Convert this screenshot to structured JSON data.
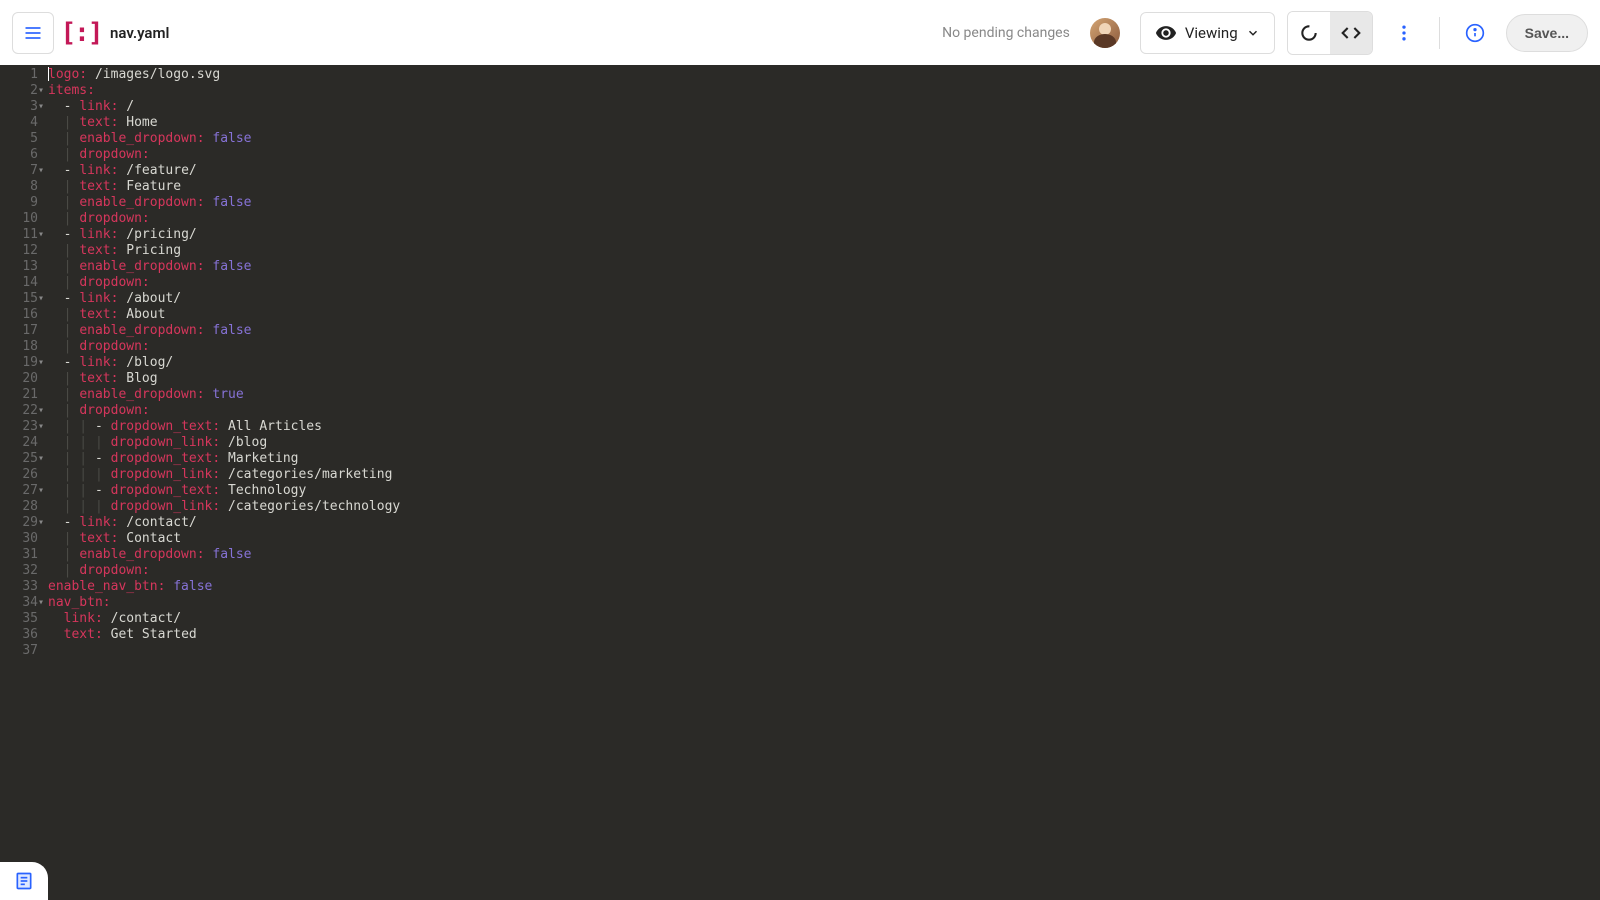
{
  "header": {
    "filename": "nav.yaml",
    "pending_text": "No pending changes",
    "view_mode_label": "Viewing",
    "save_label": "Save..."
  },
  "code_lines": [
    {
      "n": 1,
      "fold": "",
      "segs": [
        {
          "c": "k",
          "t": "logo:"
        },
        {
          "c": "v",
          "t": " /images/logo.svg"
        }
      ]
    },
    {
      "n": 2,
      "fold": "▾",
      "segs": [
        {
          "c": "k",
          "t": "items:"
        }
      ]
    },
    {
      "n": 3,
      "fold": "▾",
      "segs": [
        {
          "c": "pipe",
          "t": "  "
        },
        {
          "c": "dash",
          "t": "- "
        },
        {
          "c": "k",
          "t": "link:"
        },
        {
          "c": "v",
          "t": " /"
        }
      ]
    },
    {
      "n": 4,
      "fold": "",
      "segs": [
        {
          "c": "pipe",
          "t": "  | "
        },
        {
          "c": "k",
          "t": "text:"
        },
        {
          "c": "v",
          "t": " Home"
        }
      ]
    },
    {
      "n": 5,
      "fold": "",
      "segs": [
        {
          "c": "pipe",
          "t": "  | "
        },
        {
          "c": "k",
          "t": "enable_dropdown:"
        },
        {
          "c": "v",
          "t": " "
        },
        {
          "c": "b",
          "t": "false"
        }
      ]
    },
    {
      "n": 6,
      "fold": "",
      "segs": [
        {
          "c": "pipe",
          "t": "  | "
        },
        {
          "c": "k",
          "t": "dropdown:"
        }
      ]
    },
    {
      "n": 7,
      "fold": "▾",
      "segs": [
        {
          "c": "pipe",
          "t": "  "
        },
        {
          "c": "dash",
          "t": "- "
        },
        {
          "c": "k",
          "t": "link:"
        },
        {
          "c": "v",
          "t": " /feature/"
        }
      ]
    },
    {
      "n": 8,
      "fold": "",
      "segs": [
        {
          "c": "pipe",
          "t": "  | "
        },
        {
          "c": "k",
          "t": "text:"
        },
        {
          "c": "v",
          "t": " Feature"
        }
      ]
    },
    {
      "n": 9,
      "fold": "",
      "segs": [
        {
          "c": "pipe",
          "t": "  | "
        },
        {
          "c": "k",
          "t": "enable_dropdown:"
        },
        {
          "c": "v",
          "t": " "
        },
        {
          "c": "b",
          "t": "false"
        }
      ]
    },
    {
      "n": 10,
      "fold": "",
      "segs": [
        {
          "c": "pipe",
          "t": "  | "
        },
        {
          "c": "k",
          "t": "dropdown:"
        }
      ]
    },
    {
      "n": 11,
      "fold": "▾",
      "segs": [
        {
          "c": "pipe",
          "t": "  "
        },
        {
          "c": "dash",
          "t": "- "
        },
        {
          "c": "k",
          "t": "link:"
        },
        {
          "c": "v",
          "t": " /pricing/"
        }
      ]
    },
    {
      "n": 12,
      "fold": "",
      "segs": [
        {
          "c": "pipe",
          "t": "  | "
        },
        {
          "c": "k",
          "t": "text:"
        },
        {
          "c": "v",
          "t": " Pricing"
        }
      ]
    },
    {
      "n": 13,
      "fold": "",
      "segs": [
        {
          "c": "pipe",
          "t": "  | "
        },
        {
          "c": "k",
          "t": "enable_dropdown:"
        },
        {
          "c": "v",
          "t": " "
        },
        {
          "c": "b",
          "t": "false"
        }
      ]
    },
    {
      "n": 14,
      "fold": "",
      "segs": [
        {
          "c": "pipe",
          "t": "  | "
        },
        {
          "c": "k",
          "t": "dropdown:"
        }
      ]
    },
    {
      "n": 15,
      "fold": "▾",
      "segs": [
        {
          "c": "pipe",
          "t": "  "
        },
        {
          "c": "dash",
          "t": "- "
        },
        {
          "c": "k",
          "t": "link:"
        },
        {
          "c": "v",
          "t": " /about/"
        }
      ]
    },
    {
      "n": 16,
      "fold": "",
      "segs": [
        {
          "c": "pipe",
          "t": "  | "
        },
        {
          "c": "k",
          "t": "text:"
        },
        {
          "c": "v",
          "t": " About"
        }
      ]
    },
    {
      "n": 17,
      "fold": "",
      "segs": [
        {
          "c": "pipe",
          "t": "  | "
        },
        {
          "c": "k",
          "t": "enable_dropdown:"
        },
        {
          "c": "v",
          "t": " "
        },
        {
          "c": "b",
          "t": "false"
        }
      ]
    },
    {
      "n": 18,
      "fold": "",
      "segs": [
        {
          "c": "pipe",
          "t": "  | "
        },
        {
          "c": "k",
          "t": "dropdown:"
        }
      ]
    },
    {
      "n": 19,
      "fold": "▾",
      "segs": [
        {
          "c": "pipe",
          "t": "  "
        },
        {
          "c": "dash",
          "t": "- "
        },
        {
          "c": "k",
          "t": "link:"
        },
        {
          "c": "v",
          "t": " /blog/"
        }
      ]
    },
    {
      "n": 20,
      "fold": "",
      "segs": [
        {
          "c": "pipe",
          "t": "  | "
        },
        {
          "c": "k",
          "t": "text:"
        },
        {
          "c": "v",
          "t": " Blog"
        }
      ]
    },
    {
      "n": 21,
      "fold": "",
      "segs": [
        {
          "c": "pipe",
          "t": "  | "
        },
        {
          "c": "k",
          "t": "enable_dropdown:"
        },
        {
          "c": "v",
          "t": " "
        },
        {
          "c": "b",
          "t": "true"
        }
      ]
    },
    {
      "n": 22,
      "fold": "▾",
      "segs": [
        {
          "c": "pipe",
          "t": "  | "
        },
        {
          "c": "k",
          "t": "dropdown:"
        }
      ]
    },
    {
      "n": 23,
      "fold": "▾",
      "segs": [
        {
          "c": "pipe",
          "t": "  | | "
        },
        {
          "c": "dash",
          "t": "- "
        },
        {
          "c": "k",
          "t": "dropdown_text:"
        },
        {
          "c": "v",
          "t": " All Articles"
        }
      ]
    },
    {
      "n": 24,
      "fold": "",
      "segs": [
        {
          "c": "pipe",
          "t": "  | | | "
        },
        {
          "c": "k",
          "t": "dropdown_link:"
        },
        {
          "c": "v",
          "t": " /blog"
        }
      ]
    },
    {
      "n": 25,
      "fold": "▾",
      "segs": [
        {
          "c": "pipe",
          "t": "  | | "
        },
        {
          "c": "dash",
          "t": "- "
        },
        {
          "c": "k",
          "t": "dropdown_text:"
        },
        {
          "c": "v",
          "t": " Marketing"
        }
      ]
    },
    {
      "n": 26,
      "fold": "",
      "segs": [
        {
          "c": "pipe",
          "t": "  | | | "
        },
        {
          "c": "k",
          "t": "dropdown_link:"
        },
        {
          "c": "v",
          "t": " /categories/marketing"
        }
      ]
    },
    {
      "n": 27,
      "fold": "▾",
      "segs": [
        {
          "c": "pipe",
          "t": "  | | "
        },
        {
          "c": "dash",
          "t": "- "
        },
        {
          "c": "k",
          "t": "dropdown_text:"
        },
        {
          "c": "v",
          "t": " Technology"
        }
      ]
    },
    {
      "n": 28,
      "fold": "",
      "segs": [
        {
          "c": "pipe",
          "t": "  | | | "
        },
        {
          "c": "k",
          "t": "dropdown_link:"
        },
        {
          "c": "v",
          "t": " /categories/technology"
        }
      ]
    },
    {
      "n": 29,
      "fold": "▾",
      "segs": [
        {
          "c": "pipe",
          "t": "  "
        },
        {
          "c": "dash",
          "t": "- "
        },
        {
          "c": "k",
          "t": "link:"
        },
        {
          "c": "v",
          "t": " /contact/"
        }
      ]
    },
    {
      "n": 30,
      "fold": "",
      "segs": [
        {
          "c": "pipe",
          "t": "  | "
        },
        {
          "c": "k",
          "t": "text:"
        },
        {
          "c": "v",
          "t": " Contact"
        }
      ]
    },
    {
      "n": 31,
      "fold": "",
      "segs": [
        {
          "c": "pipe",
          "t": "  | "
        },
        {
          "c": "k",
          "t": "enable_dropdown:"
        },
        {
          "c": "v",
          "t": " "
        },
        {
          "c": "b",
          "t": "false"
        }
      ]
    },
    {
      "n": 32,
      "fold": "",
      "segs": [
        {
          "c": "pipe",
          "t": "  | "
        },
        {
          "c": "k",
          "t": "dropdown:"
        }
      ]
    },
    {
      "n": 33,
      "fold": "",
      "segs": [
        {
          "c": "k",
          "t": "enable_nav_btn:"
        },
        {
          "c": "v",
          "t": " "
        },
        {
          "c": "b",
          "t": "false"
        }
      ]
    },
    {
      "n": 34,
      "fold": "▾",
      "segs": [
        {
          "c": "k",
          "t": "nav_btn:"
        }
      ]
    },
    {
      "n": 35,
      "fold": "",
      "segs": [
        {
          "c": "pipe",
          "t": "  "
        },
        {
          "c": "k",
          "t": "link:"
        },
        {
          "c": "v",
          "t": " /contact/"
        }
      ]
    },
    {
      "n": 36,
      "fold": "",
      "segs": [
        {
          "c": "pipe",
          "t": "  "
        },
        {
          "c": "k",
          "t": "text:"
        },
        {
          "c": "v",
          "t": " Get Started"
        }
      ]
    },
    {
      "n": 37,
      "fold": "",
      "segs": []
    }
  ]
}
